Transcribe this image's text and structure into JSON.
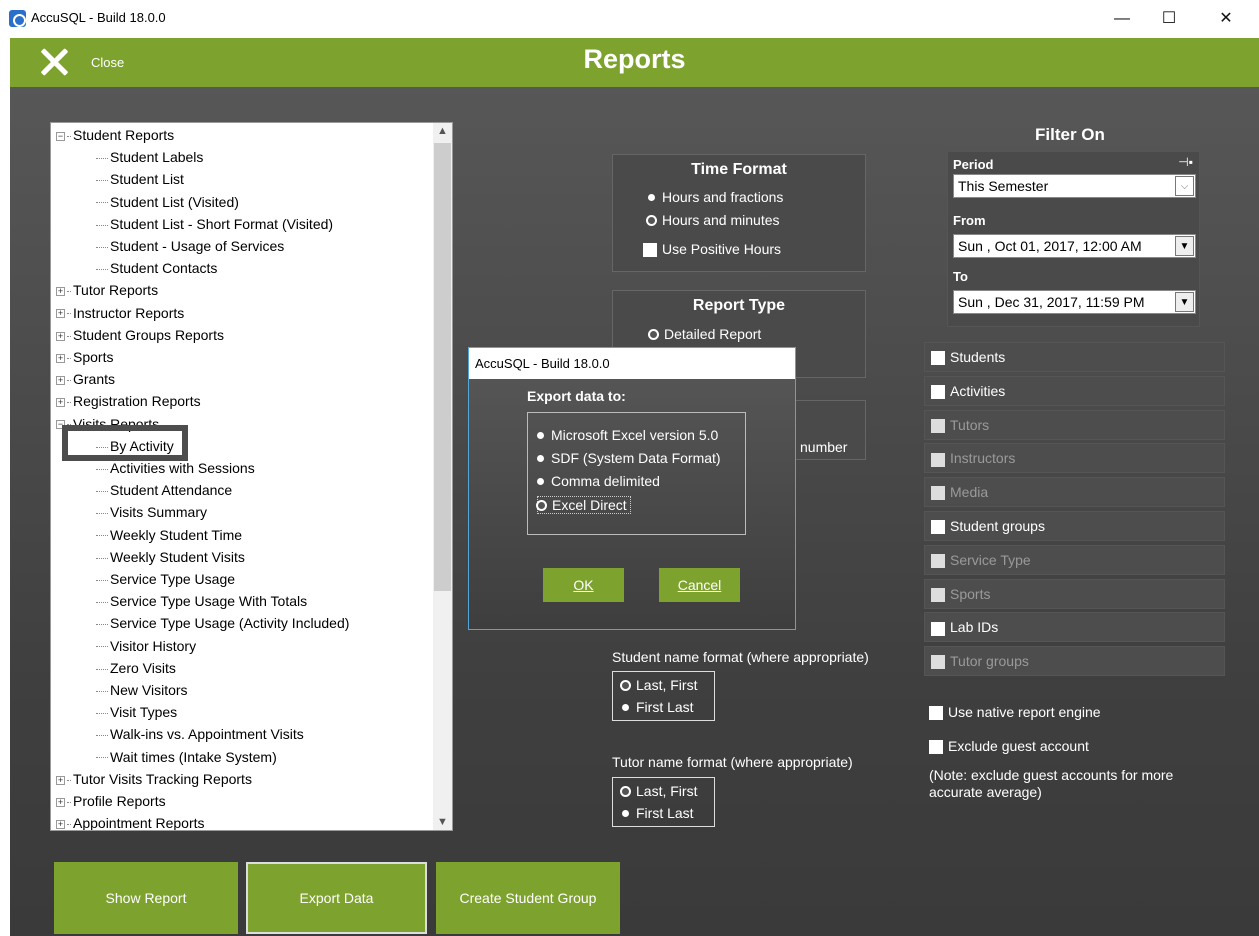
{
  "window": {
    "title": "AccuSQL - Build 18.0.0",
    "minimize": "—",
    "maximize": "☐",
    "close": "✕"
  },
  "appbar": {
    "close_label": "Close",
    "title": "Reports"
  },
  "tree": {
    "categories_top": [
      {
        "label": "Student Reports",
        "expanded": true
      }
    ],
    "student_items": [
      "Student Labels",
      "Student List",
      "Student List (Visited)",
      "Student List - Short Format (Visited)",
      "Student - Usage of Services",
      "Student Contacts"
    ],
    "categories_mid": [
      "Tutor Reports",
      "Instructor Reports",
      "Student Groups Reports",
      "Sports",
      "Grants",
      "Registration Reports",
      "Visits Reports"
    ],
    "visit_items": [
      "By Activity",
      "Activities with Sessions",
      "Student Attendance",
      "Visits Summary",
      "Weekly Student Time",
      "Weekly Student Visits",
      "Service Type Usage",
      "Service Type Usage With Totals",
      "Service Type Usage (Activity Included)",
      "Visitor History",
      "Zero Visits",
      "New Visitors",
      "Visit Types",
      "Walk-ins vs. Appointment Visits",
      "Wait times (Intake System)"
    ],
    "categories_bottom": [
      "Tutor Visits Tracking Reports",
      "Profile Reports",
      "Appointment Reports"
    ]
  },
  "time_format": {
    "title": "Time Format",
    "opt1": "Hours and fractions",
    "opt2": "Hours and minutes",
    "check": "Use Positive Hours"
  },
  "report_type": {
    "title": "Report Type",
    "opt1": "Detailed Report",
    "partial": "number"
  },
  "student_name": {
    "label": "Student name format (where appropriate)",
    "opt1": "Last, First",
    "opt2": "First Last"
  },
  "tutor_name": {
    "label": "Tutor name format (where appropriate)",
    "opt1": "Last, First",
    "opt2": "First Last"
  },
  "filter": {
    "title": "Filter On",
    "period_label": "Period",
    "period_value": "This Semester",
    "from_label": "From",
    "from_value": "Sun , Oct 01, 2017, 12:00 AM",
    "to_label": "To",
    "to_value": "Sun , Dec 31, 2017, 11:59 PM",
    "rows": [
      "Students",
      "Activities",
      "Tutors",
      "Instructors",
      "Media",
      "Student groups",
      "Service Type",
      "Sports",
      "Lab IDs",
      "Tutor groups"
    ],
    "native": "Use native report engine",
    "exclude": "Exclude guest account",
    "note": "(Note: exclude guest accounts for more accurate average)"
  },
  "buttons": {
    "show": "Show Report",
    "export": "Export Data",
    "create": "Create Student Group"
  },
  "dialog": {
    "title": "AccuSQL - Build 18.0.0",
    "heading": "Export data to:",
    "opt1": "Microsoft Excel version 5.0",
    "opt2": "SDF (System Data Format)",
    "opt3": "Comma delimited",
    "opt4": "Excel Direct",
    "ok": "OK",
    "cancel": "Cancel"
  },
  "colors": {
    "accent": "#7da22e",
    "panel": "#4a4a4a"
  }
}
